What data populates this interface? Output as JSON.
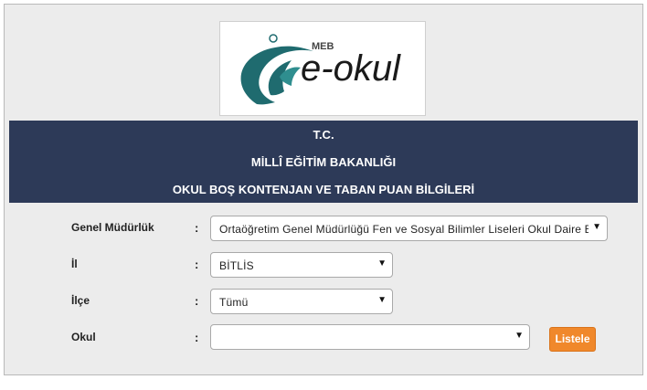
{
  "logo": {
    "brand_small": "MEB",
    "brand": "e-okul"
  },
  "header": {
    "line1": "T.C.",
    "line2": "MİLLÎ EĞİTİM BAKANLIĞI",
    "line3": "OKUL BOŞ KONTENJAN VE TABAN PUAN BİLGİLERİ"
  },
  "form": {
    "colon": ":",
    "genel_mudurluk": {
      "label": "Genel Müdürlük",
      "value": "Ortaöğretim Genel Müdürlüğü Fen ve Sosyal Bilimler Liseleri Okul Daire Başkanlığı"
    },
    "il": {
      "label": "İl",
      "value": "BİTLİS"
    },
    "ilce": {
      "label": "İlçe",
      "value": "Tümü"
    },
    "okul": {
      "label": "Okul",
      "value": ""
    }
  },
  "buttons": {
    "listele": "Listele"
  },
  "icons": {
    "dropdown": "chevron-down-icon"
  },
  "colors": {
    "header_bg": "#2d3a58",
    "button_bg": "#f0882b",
    "logo_teal": "#1f6b6f",
    "logo_red": "#c8102e"
  }
}
